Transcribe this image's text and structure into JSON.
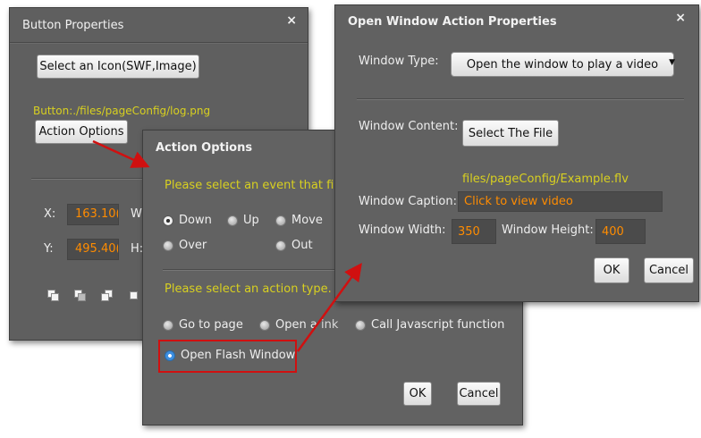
{
  "button_props": {
    "title": "Button Properties",
    "close": "×",
    "select_icon_label": "Select an Icon(SWF,Image)",
    "icon_path": "Button:./files/pageConfig/log.png",
    "action_options_label": "Action Options",
    "x_label": "X:",
    "x_value": "163.10(",
    "w_label": "W",
    "y_label": "Y:",
    "y_value": "495.40(",
    "h_label": "H:"
  },
  "action_options": {
    "title": "Action Options",
    "event_prompt": "Please select an event that fir",
    "events": [
      "Down",
      "Up",
      "Move",
      "Over",
      "Out"
    ],
    "selected_event": "Down",
    "action_prompt": "Please select an action type.",
    "actions": [
      "Go to page",
      "Open a link",
      "Call Javascript function",
      "Open Flash Window"
    ],
    "action_labels_visible": [
      "Go to page",
      "Open a",
      "ink",
      "Call Javascript function",
      "Open Flash Window"
    ],
    "selected_action": "Open Flash Window",
    "ok_label": "OK",
    "cancel_label": "Cancel"
  },
  "window_props": {
    "title": "Open Window Action Properties",
    "close": "×",
    "type_label": "Window Type:",
    "type_value": "Open the window to play a video",
    "content_label": "Window Content:",
    "select_file_label": "Select The File",
    "file_path": "files/pageConfig/Example.flv",
    "caption_label": "Window Caption:",
    "caption_value": "Click to view video",
    "width_label": "Window Width:",
    "width_value": "350",
    "height_label": "Window Height:",
    "height_value": "400",
    "ok_label": "OK",
    "cancel_label": "Cancel"
  },
  "colors": {
    "panel_bg": "#5f5f5f",
    "accent_yellow": "#d8d020",
    "value_orange": "#ff8c00",
    "highlight_red": "#d01010"
  }
}
